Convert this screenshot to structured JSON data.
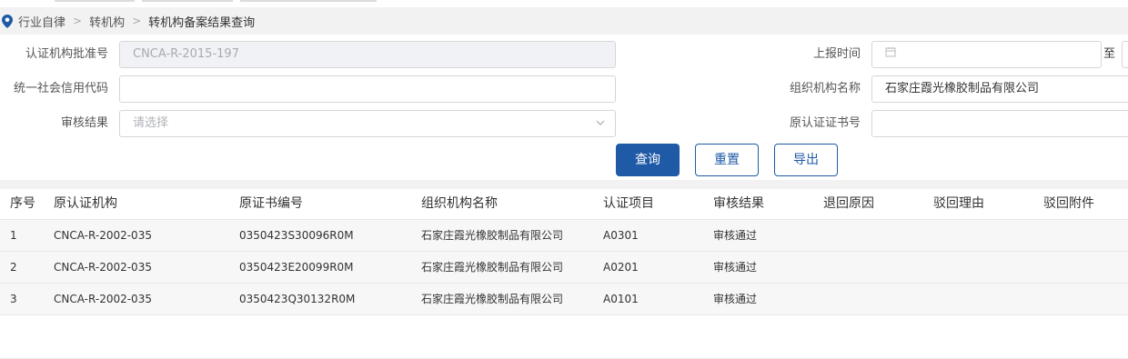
{
  "breadcrumb": {
    "items": [
      "行业自律",
      "转机构",
      "转机构备案结果查询"
    ]
  },
  "form": {
    "cert_approval_no": {
      "label": "认证机构批准号",
      "value": "CNCA-R-2015-197"
    },
    "credit_code": {
      "label": "统一社会信用代码",
      "value": ""
    },
    "audit_result": {
      "label": "审核结果",
      "placeholder": "请选择"
    },
    "report_time": {
      "label": "上报时间",
      "to": "至"
    },
    "org_name": {
      "label": "组织机构名称",
      "value": "石家庄霞光橡胶制品有限公司"
    },
    "orig_cert_no": {
      "label": "原认证证书号",
      "value": ""
    }
  },
  "buttons": {
    "query": "查询",
    "reset": "重置",
    "export": "导出"
  },
  "table": {
    "columns": [
      "序号",
      "原认证机构",
      "原证书编号",
      "组织机构名称",
      "认证项目",
      "审核结果",
      "退回原因",
      "驳回理由",
      "驳回附件"
    ],
    "rows": [
      [
        "1",
        "CNCA-R-2002-035",
        "0350423S30096R0M",
        "石家庄霞光橡胶制品有限公司",
        "A0301",
        "审核通过",
        "",
        "",
        ""
      ],
      [
        "2",
        "CNCA-R-2002-035",
        "0350423E20099R0M",
        "石家庄霞光橡胶制品有限公司",
        "A0201",
        "审核通过",
        "",
        "",
        ""
      ],
      [
        "3",
        "CNCA-R-2002-035",
        "0350423Q30132R0M",
        "石家庄霞光橡胶制品有限公司",
        "A0101",
        "审核通过",
        "",
        "",
        ""
      ]
    ]
  },
  "colors": {
    "primary": "#1f5aa6",
    "pin": "#1f5aa6"
  },
  "icons": {
    "location": "map-pin-icon",
    "calendar": "calendar-icon",
    "dropdown": "chevron-down-icon"
  }
}
